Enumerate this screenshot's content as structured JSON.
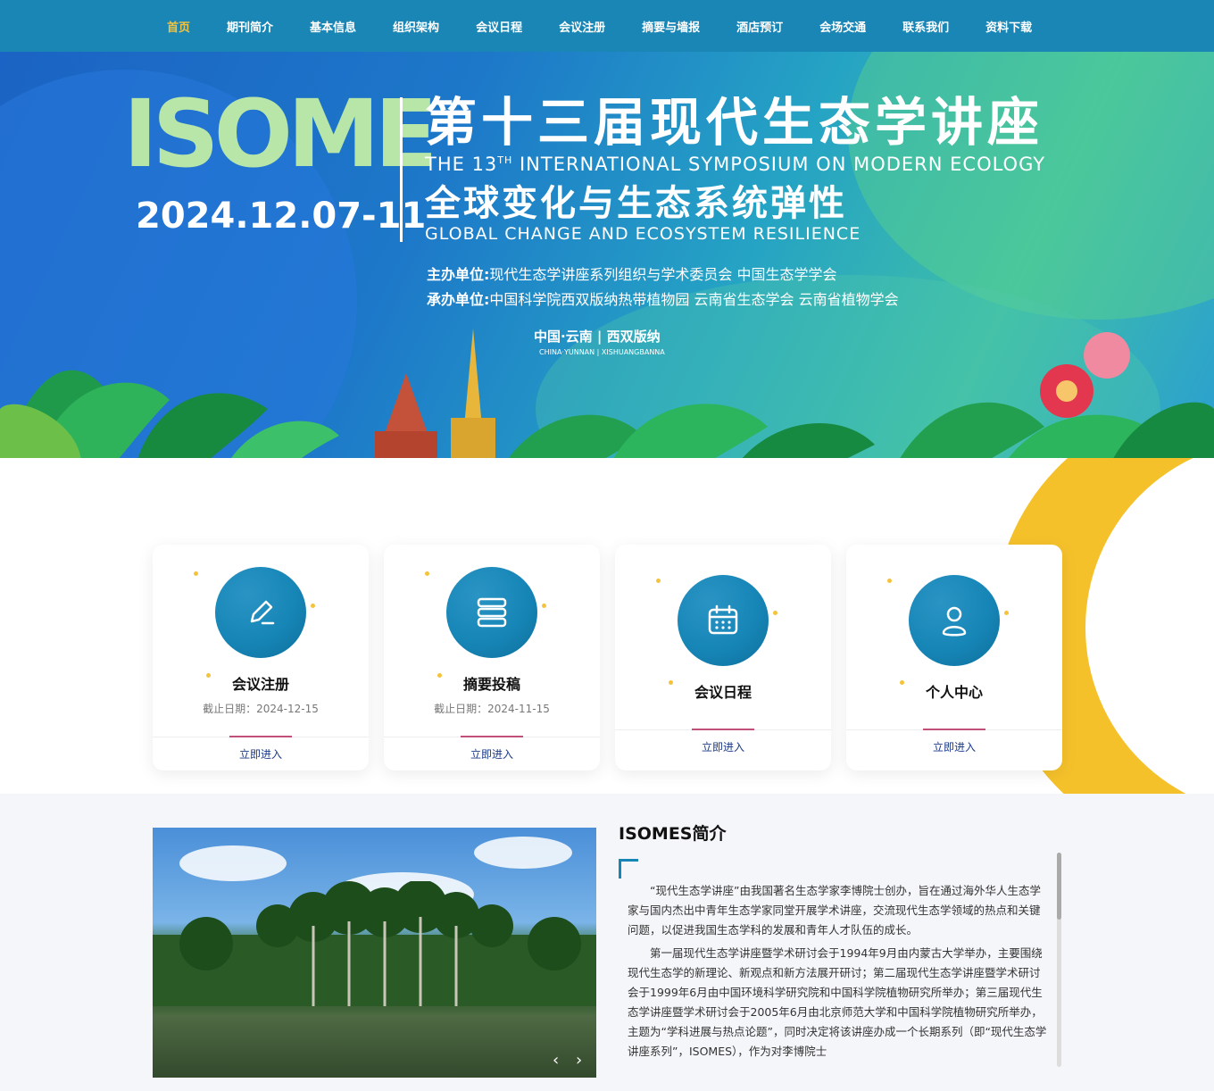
{
  "nav": {
    "items": [
      {
        "label": "首页",
        "active": true
      },
      {
        "label": "期刊简介"
      },
      {
        "label": "基本信息"
      },
      {
        "label": "组织架构"
      },
      {
        "label": "会议日程"
      },
      {
        "label": "会议注册"
      },
      {
        "label": "摘要与墙报"
      },
      {
        "label": "酒店预订"
      },
      {
        "label": "会场交通"
      },
      {
        "label": "联系我们"
      },
      {
        "label": "资料下载"
      }
    ],
    "active_color": "#f5c33b",
    "bg_color": "#1a86b5"
  },
  "banner": {
    "logo": "ISOME",
    "date": "2024.12.07-11",
    "title_cn": "第十三届现代生态学讲座",
    "title_en_pre": "THE 13",
    "title_en_sup": "TH",
    "title_en_post": " INTERNATIONAL SYMPOSIUM ON MODERN ECOLOGY",
    "theme_cn": "全球变化与生态系统弹性",
    "theme_en": "GLOBAL CHANGE AND ECOSYSTEM RESILIENCE",
    "host_label": "主办单位:",
    "host_value": "现代生态学讲座系列组织与学术委员会   中国生态学学会",
    "coorg_label": "承办单位:",
    "coorg_value": "中国科学院西双版纳热带植物园   云南省生态学会   云南省植物学会",
    "place_cn": "中国·云南 | 西双版纳",
    "place_en": "CHINA·YUNNAN  |  XISHUANGBANNA"
  },
  "cards": [
    {
      "icon": "pen-icon",
      "name": "会议注册",
      "date": "截止日期：2024-12-15",
      "button": "立即进入"
    },
    {
      "icon": "stack-icon",
      "name": "摘要投稿",
      "date": "截止日期：2024-11-15",
      "button": "立即进入"
    },
    {
      "icon": "calendar-icon",
      "name": "会议日程",
      "date": "",
      "button": "立即进入"
    },
    {
      "icon": "user-icon",
      "name": "个人中心",
      "date": "",
      "button": "立即进入"
    }
  ],
  "intro": {
    "title": "ISOMES简介",
    "paragraphs": [
      "“现代生态学讲座”由我国著名生态学家李博院士创办，旨在通过海外华人生态学家与国内杰出中青年生态学家同堂开展学术讲座，交流现代生态学领域的热点和关键问题，以促进我国生态学科的发展和青年人才队伍的成长。",
      "第一届现代生态学讲座暨学术研讨会于1994年9月由内蒙古大学举办，主要围绕现代生态学的新理论、新观点和新方法展开研讨；第二届现代生态学讲座暨学术研讨会于1999年6月由中国环境科学研究院和中国科学院植物研究所举办；第三届现代生态学讲座暨学术研讨会于2005年6月由北京师范大学和中国科学院植物研究所举办，主题为“学科进展与热点论题”，同时决定将该讲座办成一个长期系列（即“现代生态学讲座系列”，ISOMES），作为对李博院士"
    ],
    "prev": "‹",
    "next": "›"
  }
}
